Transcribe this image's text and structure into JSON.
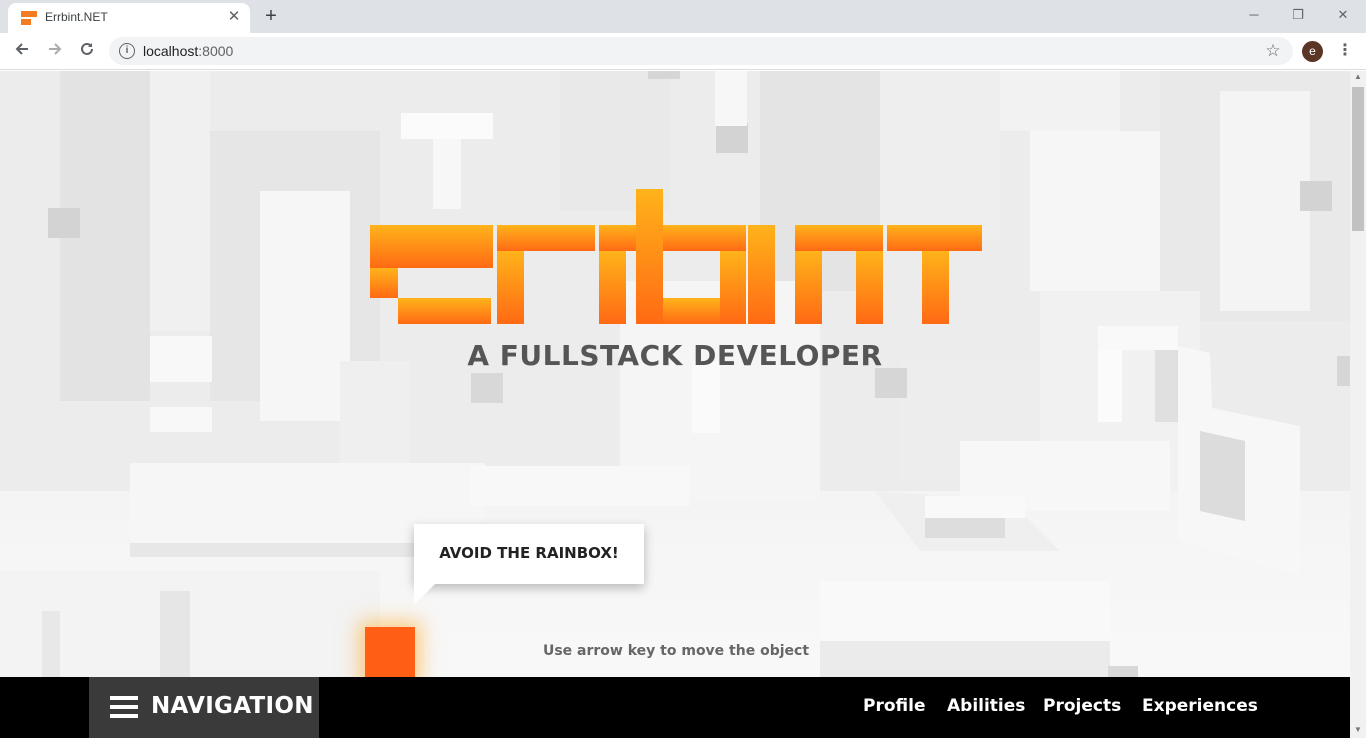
{
  "browser": {
    "tab_title": "Errbint.NET",
    "tab_close_glyph": "✕",
    "new_tab_glyph": "+",
    "url_host": "localhost",
    "url_port": ":8000",
    "avatar_letter": "e",
    "window_controls": {
      "minimize": "─",
      "restore": "❐",
      "close": "✕"
    },
    "icons": [
      "back-icon",
      "forward-icon",
      "reload-icon",
      "info-icon",
      "star-icon",
      "menu-icon"
    ]
  },
  "hero": {
    "logo_text": "errbint",
    "subtitle": "A FULLSTACK DEVELOPER"
  },
  "game": {
    "bubble_text": "AVOID THE RAINBOX!",
    "hint": "Use arrow key to move the object"
  },
  "nav": {
    "toggle_label": "NAVIGATION",
    "links": [
      "Profile",
      "Abilities",
      "Projects",
      "Experiences"
    ]
  },
  "colors": {
    "brand_orange_top": "#ffb31a",
    "brand_orange_bottom": "#ff6a14",
    "player": "#ff5e14",
    "navbar": "#000000",
    "nav_toggle": "#3a3a3a"
  }
}
